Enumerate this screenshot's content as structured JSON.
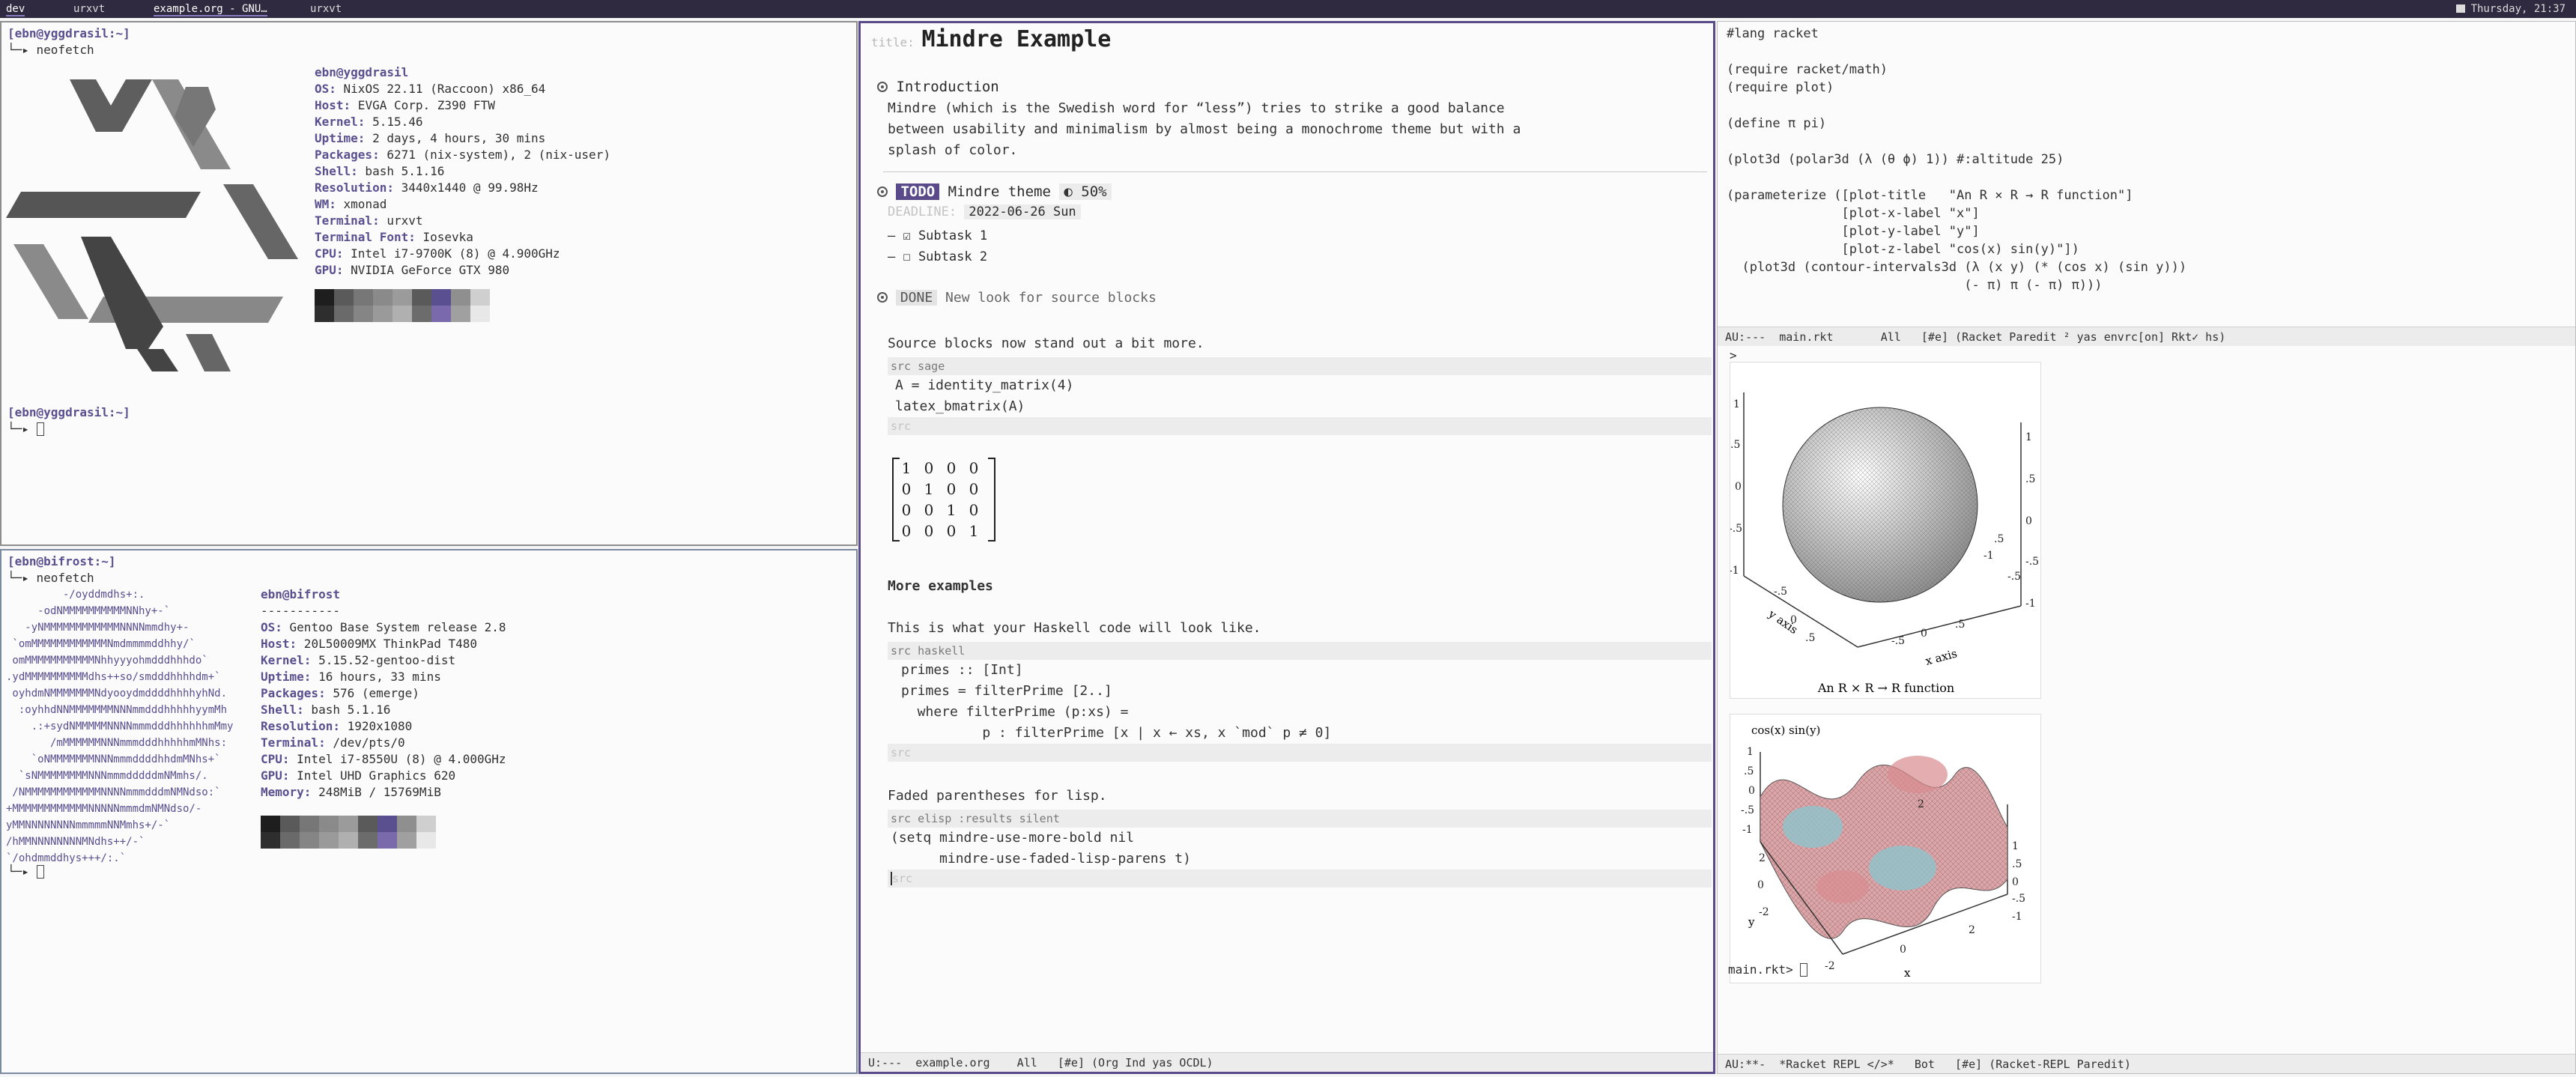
{
  "topbar": {
    "workspaces": [
      "dev",
      "urxvt",
      "example.org - GNU…",
      "urxvt"
    ],
    "clock": "Thursday, 21:37"
  },
  "term1": {
    "prompt_user": "[ebn@yggdrasil:~]",
    "command": "└─▸ neofetch",
    "header": "ebn@yggdrasil",
    "info": [
      {
        "k": "OS",
        "v": "NixOS 22.11 (Raccoon) x86_64"
      },
      {
        "k": "Host",
        "v": "EVGA Corp. Z390 FTW"
      },
      {
        "k": "Kernel",
        "v": "5.15.46"
      },
      {
        "k": "Uptime",
        "v": "2 days, 4 hours, 30 mins"
      },
      {
        "k": "Packages",
        "v": "6271 (nix-system), 2 (nix-user)"
      },
      {
        "k": "Shell",
        "v": "bash 5.1.16"
      },
      {
        "k": "Resolution",
        "v": "3440x1440 @ 99.98Hz"
      },
      {
        "k": "WM",
        "v": "xmonad"
      },
      {
        "k": "Terminal",
        "v": "urxvt"
      },
      {
        "k": "Terminal Font",
        "v": "Iosevka"
      },
      {
        "k": "CPU",
        "v": "Intel i7-9700K (8) @ 4.900GHz"
      },
      {
        "k": "GPU",
        "v": "NVIDIA GeForce GTX 980"
      }
    ],
    "prompt2_user": "[ebn@yggdrasil:~]",
    "prompt2_arrow": "└─▸"
  },
  "term2": {
    "prompt_user": "[ebn@bifrost:~]",
    "command": "└─▸ neofetch",
    "ascii": [
      "         -/oyddmdhs+:.",
      "     -odNMMMMMMMMMMNNhy+-`",
      "   -yNMMMMMMMMMMMMNNNNmmdhy+-",
      " `omMMMMMMMMMMMMNmdmmmmddhhy/`",
      " omMMMMMMMMMMMNhhyyyohmdddhhhdo`",
      ".ydMMMMMMMMMMdhs++so/smdddhhhhdm+`",
      " oyhdmNMMMMMMMNdyooydmddddhhhhyhNd.",
      "  :oyhhdNNMMMMMMMNNNmmdddhhhhhyymMh",
      "    .:+sydNMMMMMNNNNmmmdddhhhhhhmMmy",
      "       /mMMMMMMNNNmmmdddhhhhhmMNhs:",
      "    `oNMMMMMMMNNNmmmddddhhdmMNhs+`",
      "  `sNMMMMMMMMNNNmmmdddddmNMmhs/.",
      " /NMMMMMMMMMMMMNNNNmmmdddmNMNdso:`",
      "+MMMMMMMMMMMMNNNNNmmmdmNMNdso/-",
      "yMMNNNNNNNNmmmmmNNMmhs+/-`",
      "/hMMNNNNNNNNMNdhs++/-`",
      "`/ohdmmddhys+++/:.`"
    ],
    "header": "ebn@bifrost",
    "sep": "-----------",
    "info": [
      {
        "k": "OS",
        "v": "Gentoo Base System release 2.8"
      },
      {
        "k": "Host",
        "v": "20L50009MX ThinkPad T480"
      },
      {
        "k": "Kernel",
        "v": "5.15.52-gentoo-dist"
      },
      {
        "k": "Uptime",
        "v": "16 hours, 33 mins"
      },
      {
        "k": "Packages",
        "v": "576 (emerge)"
      },
      {
        "k": "Shell",
        "v": "bash 5.1.16"
      },
      {
        "k": "Resolution",
        "v": "1920x1080"
      },
      {
        "k": "Terminal",
        "v": "/dev/pts/0"
      },
      {
        "k": "CPU",
        "v": "Intel i7-8550U (8) @ 4.000GHz"
      },
      {
        "k": "GPU",
        "v": "Intel UHD Graphics 620"
      },
      {
        "k": "Memory",
        "v": "248MiB / 15769MiB"
      }
    ],
    "prompt2_arrow": "└─▸"
  },
  "palette": {
    "top": [
      "#1e1e1e",
      "#5a5a5a",
      "#777777",
      "#8a8a8a",
      "#9b9b9b",
      "#5a5a5a",
      "#5a4f8f",
      "#8f8f8f",
      "#cfcfcf"
    ],
    "bottom": [
      "#2e2e2e",
      "#6a6a6a",
      "#858585",
      "#9a9a9a",
      "#b0b0b0",
      "#6c6c6c",
      "#7a6aab",
      "#a0a0a0",
      "#e8e8e8"
    ]
  },
  "org": {
    "title_label": "title:",
    "title": "Mindre Example",
    "intro_heading": "Introduction",
    "intro_text": [
      "Mindre (which is the Swedish word for “less”) tries to strike a good balance",
      "between usability and minimalism by almost being a monochrome theme but with a",
      "splash of color."
    ],
    "todo_tag": "TODO",
    "todo_heading": "Mindre theme",
    "todo_progress": "◐ 50%",
    "deadline_label": "DEADLINE:",
    "deadline_date": "2022-06-26 Sun",
    "subtasks": [
      "– ☑ Subtask 1",
      "– ☐ Subtask 2"
    ],
    "done_tag": "DONE",
    "done_heading": "New look for source blocks",
    "src_intro": "Source blocks now stand out a bit more.",
    "src1_head": "src sage",
    "src1_lines": [
      "A = identity_matrix(4)",
      "latex_bmatrix(A)"
    ],
    "src_end": "src",
    "matrix": [
      [
        "1",
        "0",
        "0",
        "0"
      ],
      [
        "0",
        "1",
        "0",
        "0"
      ],
      [
        "0",
        "0",
        "1",
        "0"
      ],
      [
        "0",
        "0",
        "0",
        "1"
      ]
    ],
    "more_heading": "More examples",
    "haskell_intro": "This is what your Haskell code will look like.",
    "src2_head": "src haskell",
    "haskell_lines": [
      "primes :: [Int]",
      "primes = filterPrime [2..]",
      "  where filterPrime (p:xs) =",
      "          p : filterPrime [x | x ← xs, x `mod` p ≠ 0]"
    ],
    "lisp_intro": "Faded parentheses for lisp.",
    "src3_head": "src elisp :results silent",
    "lisp_lines": [
      "(setq mindre-use-more-bold nil",
      "      mindre-use-faded-lisp-parens t)"
    ],
    "modeline": "U:---  example.org    All   [#e] (Org Ind yas OCDL)"
  },
  "racket": {
    "code": [
      "#lang racket",
      "",
      "(require racket/math)",
      "(require plot)",
      "",
      "(define π pi)",
      "",
      "(plot3d (polar3d (λ (θ ϕ) 1)) #:altitude 25)",
      "",
      "(parameterize ([plot-title   \"An R × R → R function\"]",
      "               [plot-x-label \"x\"]",
      "               [plot-y-label \"y\"]",
      "               [plot-z-label \"cos(x) sin(y)\"])",
      "  (plot3d (contour-intervals3d (λ (x y) (* (cos x) (sin y)))",
      "                               (- π) π (- π) π)))"
    ],
    "modeline_top": "AU:---  main.rkt       All   [#e] (Racket Paredit ² yas envrc[on] Rkt✓ hs)",
    "repl_prompt_first": ">",
    "plot1_title": "An R × R → R function",
    "plot1_xaxis": "x axis",
    "plot1_yaxis": "y axis",
    "plot2_zlabel": "cos(x) sin(y)",
    "plot2_x": "x",
    "plot2_y": "y",
    "repl_prompt": "main.rkt>",
    "modeline_bottom": "AU:**-  *Racket REPL </>*   Bot   [#e] (Racket-REPL Paredit)"
  }
}
